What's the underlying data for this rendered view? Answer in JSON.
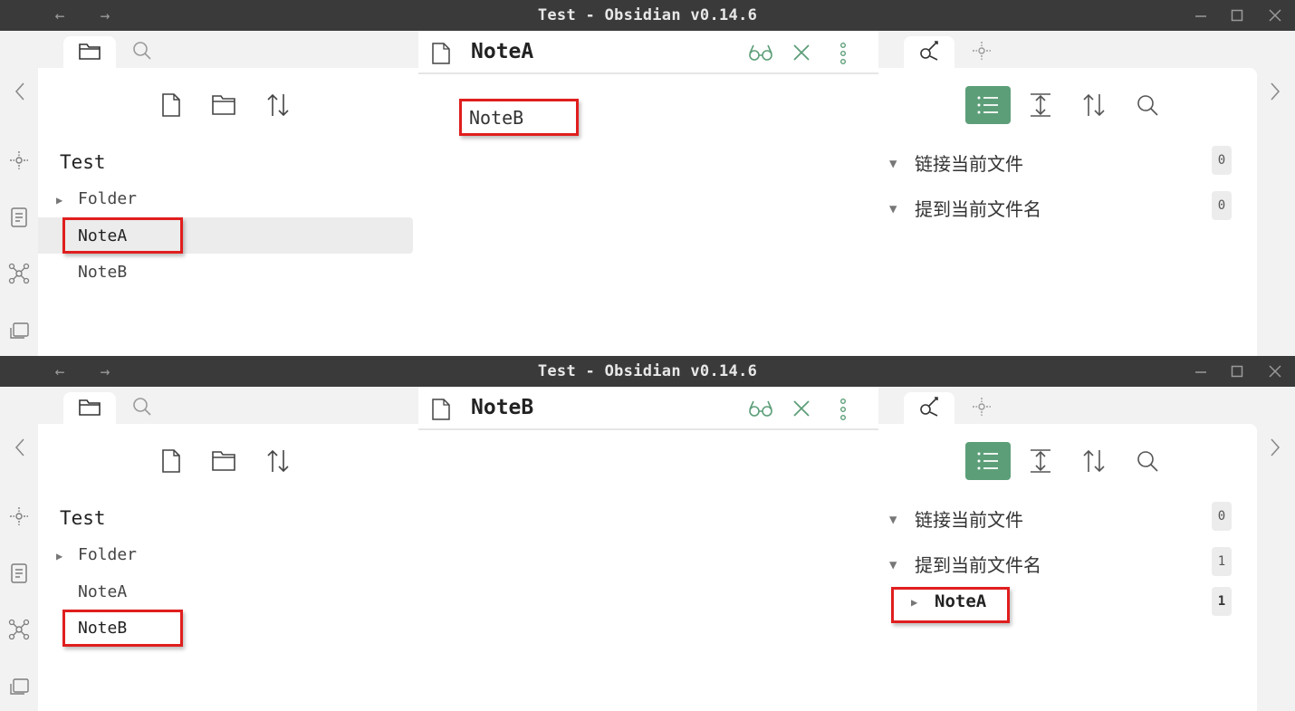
{
  "screens": [
    {
      "window_title": "Test - Obsidian v0.14.6",
      "vault": "Test",
      "files": [
        {
          "label": "Folder",
          "type": "folder"
        },
        {
          "label": "NoteA",
          "type": "note"
        },
        {
          "label": "NoteB",
          "type": "note"
        }
      ],
      "active_note": "NoteA",
      "editor_content": "NoteB",
      "backlinks": {
        "linked_label": "链接当前文件",
        "linked_count": "0",
        "unlinked_label": "提到当前文件名",
        "unlinked_count": "0"
      }
    },
    {
      "window_title": "Test - Obsidian v0.14.6",
      "vault": "Test",
      "files": [
        {
          "label": "Folder",
          "type": "folder"
        },
        {
          "label": "NoteA",
          "type": "note"
        },
        {
          "label": "NoteB",
          "type": "note"
        }
      ],
      "active_note": "NoteB",
      "editor_content": "",
      "backlinks": {
        "linked_label": "链接当前文件",
        "linked_count": "0",
        "unlinked_label": "提到当前文件名",
        "unlinked_count": "1",
        "results": [
          {
            "label": "NoteA",
            "count": "1"
          }
        ]
      }
    }
  ],
  "colors": {
    "titlebar": "#3a3a3a",
    "accent_green": "#5c9e78",
    "highlight_red": "#e01e1e",
    "selected_row": "#ececec"
  },
  "icons": {
    "nav": [
      "back-arrow-icon",
      "forward-arrow-icon"
    ],
    "window": [
      "minimize-icon",
      "maximize-icon",
      "close-window-icon"
    ],
    "left_tabs": [
      "folder-tab-icon",
      "search-tab-icon"
    ],
    "ribbon": [
      "graph-plugin-icon",
      "template-icon",
      "graph-view-icon",
      "stack-icon"
    ],
    "file_toolbar": [
      "new-note-icon",
      "new-folder-icon",
      "sort-icon"
    ],
    "editor_actions": [
      "reading-mode-icon",
      "close-icon",
      "more-options-icon"
    ],
    "right_tabs": [
      "backlinks-tab-icon",
      "outgoing-tab-icon"
    ],
    "backlink_toolbar": [
      "collapse-results-icon",
      "expand-icon",
      "sort-icon",
      "search-icon"
    ]
  }
}
